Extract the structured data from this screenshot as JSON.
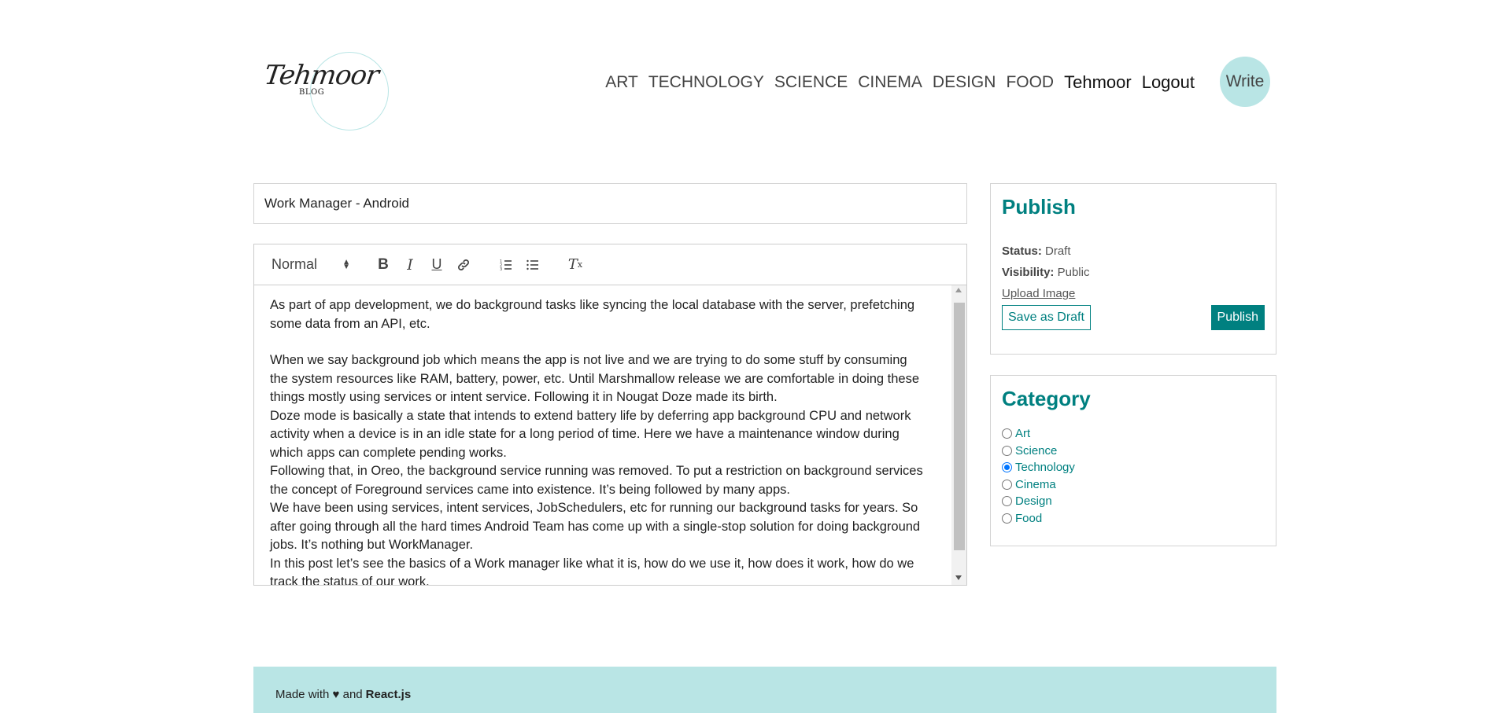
{
  "logo": {
    "script": "Tehmoor",
    "sub": "BLOG"
  },
  "nav": {
    "links": [
      "ART",
      "TECHNOLOGY",
      "SCIENCE",
      "CINEMA",
      "DESIGN",
      "FOOD"
    ],
    "user": "Tehmoor",
    "logout": "Logout",
    "write": "Write"
  },
  "editor": {
    "title_value": "Work Manager - Android",
    "format_select": "Normal",
    "toolbar_icons": [
      "bold-icon",
      "italic-icon",
      "underline-icon",
      "link-icon",
      "ordered-list-icon",
      "bullet-list-icon",
      "clear-format-icon"
    ],
    "paragraphs": [
      "As part of app development, we do background tasks like syncing the local database with the server, prefetching some data from an API, etc.",
      "When we say background job which means the app is not live and we are trying to do some stuff by consuming the system resources like RAM, battery, power, etc. Until Marshmallow release we are comfortable in doing these things mostly using services or intent service. Following it in Nougat Doze made its birth.",
      "Doze mode is basically a state that intends to extend battery life by deferring app background CPU and network activity when a device is in an idle state for a long period of time. Here we have a maintenance window during which apps can complete pending works.",
      "Following that, in Oreo, the background service running was removed. To put a restriction on background services the concept of Foreground services came into existence. It’s being followed by many apps.",
      "We have been using services, intent services, JobSchedulers, etc for running our background tasks for years. So after going through all the hard times Android Team has come up with a single-stop solution for doing background jobs. It’s nothing but WorkManager.",
      "In this post let’s see the basics of a Work manager like what it is, how do we use it, how does it work, how do we track the status of our work."
    ]
  },
  "publish": {
    "heading": "Publish",
    "status_label": "Status:",
    "status_value": "Draft",
    "visibility_label": "Visibility:",
    "visibility_value": "Public",
    "upload": "Upload Image",
    "save_draft": "Save as Draft",
    "publish_btn": "Publish"
  },
  "category": {
    "heading": "Category",
    "items": [
      "Art",
      "Science",
      "Technology",
      "Cinema",
      "Design",
      "Food"
    ],
    "selected": "Technology"
  },
  "footer": {
    "prefix": "Made with ♥ and",
    "brand": "React.js"
  },
  "colors": {
    "accent": "#008080",
    "footer_bg": "#b9e5e5"
  }
}
